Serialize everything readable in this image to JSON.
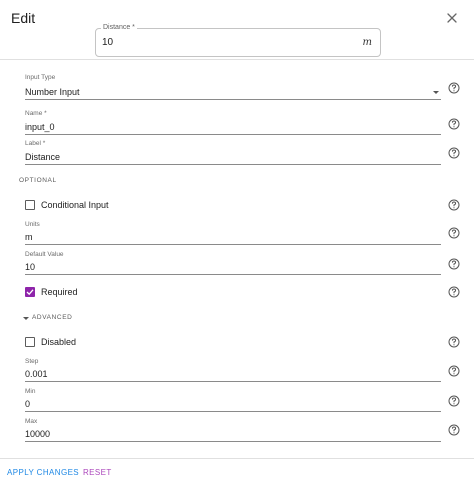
{
  "dialog": {
    "title": "Edit"
  },
  "preview": {
    "label": "Distance *",
    "value": "10",
    "unit": "m"
  },
  "fields": {
    "input_type": {
      "label": "Input Type",
      "value": "Number Input"
    },
    "name": {
      "label": "Name *",
      "value": "input_0"
    },
    "label": {
      "label": "Label *",
      "value": "Distance"
    },
    "units": {
      "label": "Units",
      "value": "m"
    },
    "default_value": {
      "label": "Default Value",
      "value": "10"
    },
    "step": {
      "label": "Step",
      "value": "0.001"
    },
    "min": {
      "label": "Min",
      "value": "0"
    },
    "max": {
      "label": "Max",
      "value": "10000"
    }
  },
  "sections": {
    "optional": "OPTIONAL",
    "advanced": "ADVANCED"
  },
  "checkboxes": {
    "conditional_input": {
      "label": "Conditional Input",
      "checked": false
    },
    "required": {
      "label": "Required",
      "checked": true
    },
    "disabled": {
      "label": "Disabled",
      "checked": false
    }
  },
  "footer": {
    "apply_label": "APPLY CHANGES",
    "reset_label": "RESET"
  },
  "colors": {
    "accent_purple": "#8e24aa",
    "apply_blue": "#1e88e5",
    "reset_purple": "#ab47bc"
  },
  "icons": {
    "close": "close-icon",
    "help": "help-circle-icon",
    "dropdown": "chevron-down-icon",
    "check": "check-icon"
  }
}
